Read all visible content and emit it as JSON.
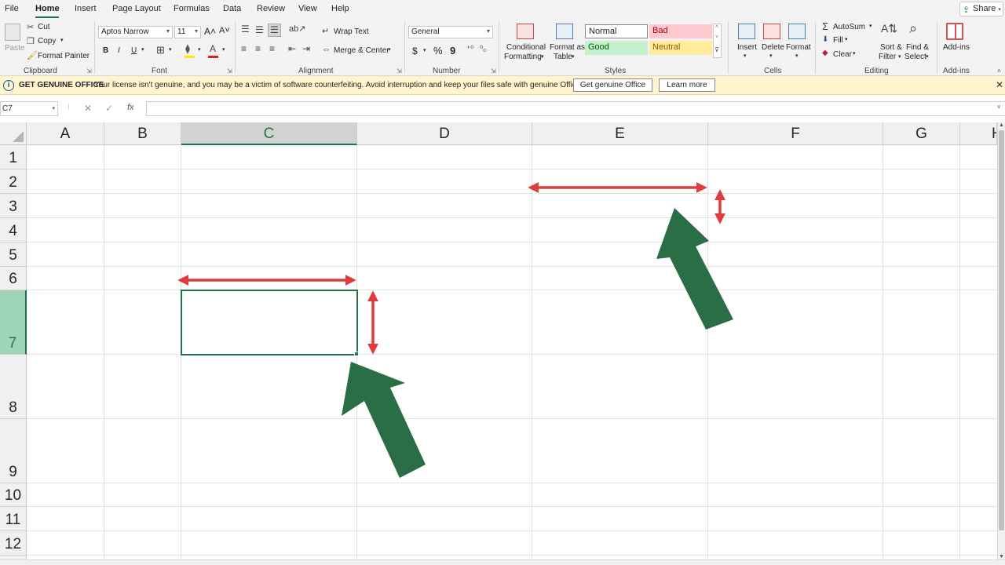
{
  "menu": {
    "tabs": [
      "File",
      "Home",
      "Insert",
      "Page Layout",
      "Formulas",
      "Data",
      "Review",
      "View",
      "Help"
    ],
    "active_tab": "Home",
    "share": "Share"
  },
  "ribbon": {
    "clipboard": {
      "label": "Clipboard",
      "paste": "Paste",
      "cut": "Cut",
      "copy": "Copy",
      "format_painter": "Format Painter"
    },
    "font": {
      "label": "Font",
      "font_name": "Aptos Narrow",
      "font_size": "11",
      "bold": "B",
      "italic": "I",
      "underline": "U"
    },
    "alignment": {
      "label": "Alignment",
      "wrap_text": "Wrap Text",
      "merge_center": "Merge & Center"
    },
    "number": {
      "label": "Number",
      "format": "General",
      "currency": "$",
      "percent": "%",
      "comma": "9"
    },
    "styles": {
      "label": "Styles",
      "conditional_line1": "Conditional",
      "conditional_line2": "Formatting",
      "format_table_line1": "Format as",
      "format_table_line2": "Table",
      "normal": "Normal",
      "bad": "Bad",
      "good": "Good",
      "neutral": "Neutral"
    },
    "cells": {
      "label": "Cells",
      "insert": "Insert",
      "delete": "Delete",
      "format": "Format"
    },
    "editing": {
      "label": "Editing",
      "autosum": "AutoSum",
      "fill": "Fill",
      "clear": "Clear",
      "sort_line1": "Sort &",
      "sort_line2": "Filter",
      "find_line1": "Find &",
      "find_line2": "Select"
    },
    "addins": {
      "label": "Add-ins",
      "button": "Add-ins"
    }
  },
  "infobar": {
    "title": "GET GENUINE OFFICE",
    "message": "Your license isn't genuine, and you may be a victim of software counterfeiting. Avoid interruption and keep your files safe with genuine Office today.",
    "btn_genuine": "Get genuine Office",
    "btn_learn": "Learn more"
  },
  "formula_bar": {
    "name_box": "C7",
    "fx": "fx",
    "formula": ""
  },
  "sheet": {
    "columns": [
      "A",
      "B",
      "C",
      "D",
      "E",
      "F",
      "G",
      "H"
    ],
    "rows": [
      "1",
      "2",
      "3",
      "4",
      "5",
      "6",
      "7",
      "8",
      "9",
      "10",
      "11",
      "12"
    ],
    "selected_cell": "C7",
    "selected_column": "C",
    "selected_row": "7"
  },
  "colors": {
    "excel_green": "#217346",
    "annotation_red": "#e03c3c",
    "annotation_arrow_green": "#2a6e45"
  }
}
